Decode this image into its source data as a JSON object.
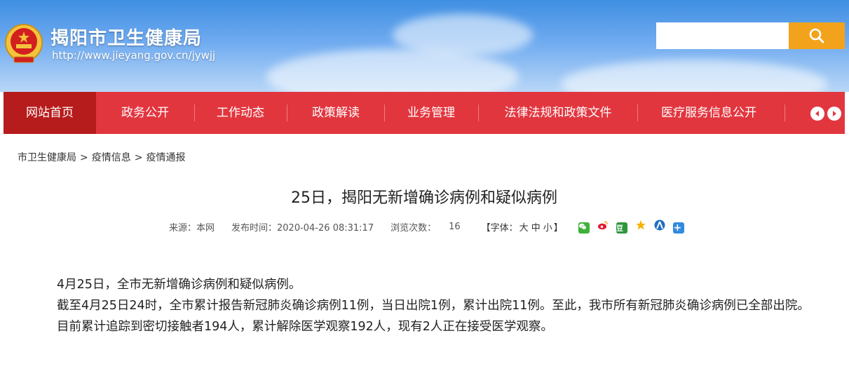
{
  "header": {
    "site_title": "揭阳市卫生健康局",
    "site_url": "http://www.jieyang.gov.cn/jywjj",
    "search_placeholder": "",
    "search_button_color": "#f2a31b"
  },
  "nav": {
    "bar_color": "#e2363f",
    "active_color": "#b71c1c",
    "items": [
      {
        "label": "网站首页"
      },
      {
        "label": "政务公开"
      },
      {
        "label": "工作动态"
      },
      {
        "label": "政策解读"
      },
      {
        "label": "业务管理"
      },
      {
        "label": "法律法规和政策文件"
      },
      {
        "label": "医疗服务信息公开"
      }
    ],
    "prev_icon": "arrow-left-icon",
    "next_icon": "arrow-right-icon"
  },
  "breadcrumb": {
    "items": [
      "市卫生健康局",
      "疫情信息",
      "疫情通报"
    ],
    "separator": ">"
  },
  "article": {
    "title": "25日，揭阳无新增确诊病例和疑似病例",
    "source_label": "来源：本网",
    "publish_label": "发布时间：2020-04-26 08:31:17",
    "views_label": "浏览次数：",
    "views_count": "16",
    "font_size_label": "【字体：",
    "font_large": "大",
    "font_medium": "中",
    "font_small": "小",
    "font_size_close": "】",
    "paragraphs": [
      "4月25日，全市无新增确诊病例和疑似病例。",
      "截至4月25日24时，全市累计报告新冠肺炎确诊病例11例，当日出院1例，累计出院11例。至此，我市所有新冠肺炎确诊病例已全部出院。",
      "目前累计追踪到密切接触者194人，累计解除医学观察192人，现有2人正在接受医学观察。"
    ]
  },
  "share": [
    {
      "name": "wechat-icon",
      "color": "#3fb13a"
    },
    {
      "name": "weibo-icon",
      "color": "#e6162d"
    },
    {
      "name": "douban-icon",
      "color": "#2e963d"
    },
    {
      "name": "qzone-icon",
      "color": "#f5b400"
    },
    {
      "name": "renren-icon",
      "color": "#1f6fbf"
    },
    {
      "name": "more-share-icon",
      "color": "#2f8ae0"
    }
  ]
}
